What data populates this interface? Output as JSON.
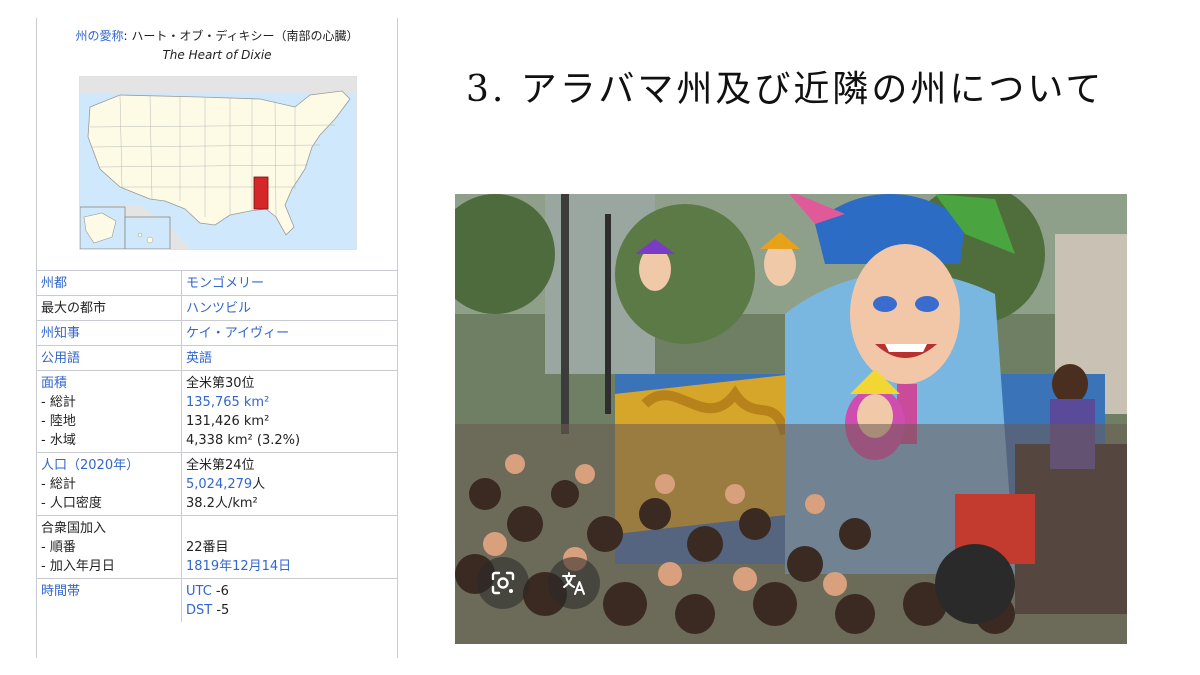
{
  "infobox": {
    "nickname_label": "州の愛称",
    "nickname_sep": ": ",
    "nickname_ja": "ハート・オブ・ディキシー（南部の心臓）",
    "nickname_en": "The Heart of Dixie",
    "rows": [
      {
        "label": "州都",
        "label_link": true,
        "value": "モンゴメリー",
        "value_link": true
      },
      {
        "label": "最大の都市",
        "label_link": false,
        "value": "ハンツビル",
        "value_link": true
      },
      {
        "label": "州知事",
        "label_link": true,
        "value": "ケイ・アイヴィー",
        "value_link": true
      },
      {
        "label": "公用語",
        "label_link": true,
        "value": "英語",
        "value_link": true
      }
    ],
    "area": {
      "label": "面積",
      "subs": [
        " - 総計",
        " - 陸地",
        " - 水域"
      ],
      "rank": "全米第30位",
      "total": "135,765 km²",
      "land": "131,426 km²",
      "water": "4,338 km² (3.2%)"
    },
    "population": {
      "label": "人口（",
      "year": "2020年",
      "label_end": "）",
      "subs": [
        " - 総計",
        " - 人口密度"
      ],
      "rank": "全米第24位",
      "total_num": "5,024,279",
      "total_unit": "人",
      "density": "38.2人/km²"
    },
    "admission": {
      "label": "合衆国加入",
      "subs": [
        " - 順番",
        " - 加入年月日"
      ],
      "order": "22番目",
      "date": "1819年12月14日"
    },
    "timezone": {
      "label": "時間帯",
      "utc_label": "UTC",
      "utc_val": " -6",
      "dst_label": "DST",
      "dst_val": " -5"
    }
  },
  "slide": {
    "heading": "3. アラバマ州及び近隣の州について"
  },
  "photo_overlay": {
    "lens_icon": "google-lens-icon",
    "translate_icon": "translate-icon"
  },
  "colors": {
    "link": "#3366cc",
    "alabama": "#d62728",
    "us_land": "#fdfbe6",
    "ocean": "#cfe8fb"
  }
}
